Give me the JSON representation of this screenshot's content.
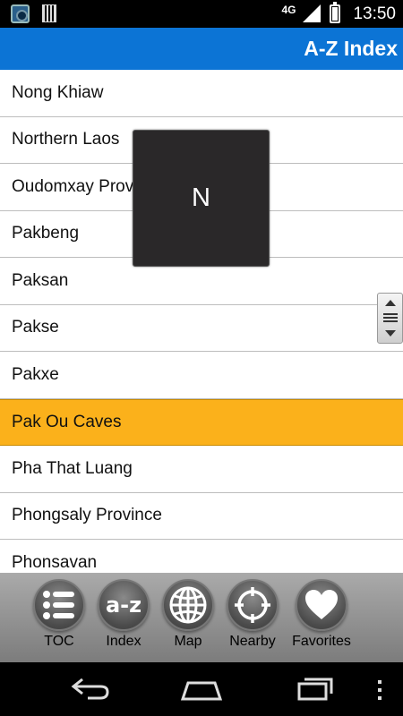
{
  "status_bar": {
    "network": "4G",
    "time": "13:50"
  },
  "header": {
    "title": "A-Z Index"
  },
  "list": {
    "items": [
      "Nong Khiaw",
      "Northern Laos",
      "Oudomxay Province",
      "Pakbeng",
      "Paksan",
      "Pakse",
      "Pakxe",
      "Pak Ou Caves",
      "Pha That Luang",
      "Phongsaly Province",
      "Phonsavan"
    ],
    "selected_index": 7
  },
  "letter_popup": {
    "letter": "N"
  },
  "toolbar": {
    "buttons": [
      {
        "label": "TOC",
        "icon": "list-icon"
      },
      {
        "label": "Index",
        "icon": "a-z-icon",
        "icon_text": "a-z"
      },
      {
        "label": "Map",
        "icon": "globe-icon"
      },
      {
        "label": "Nearby",
        "icon": "crosshair-icon"
      },
      {
        "label": "Favorites",
        "icon": "heart-icon"
      }
    ]
  },
  "colors": {
    "header_bg": "#0c74d5",
    "selected_row_bg": "#fbb11b"
  }
}
